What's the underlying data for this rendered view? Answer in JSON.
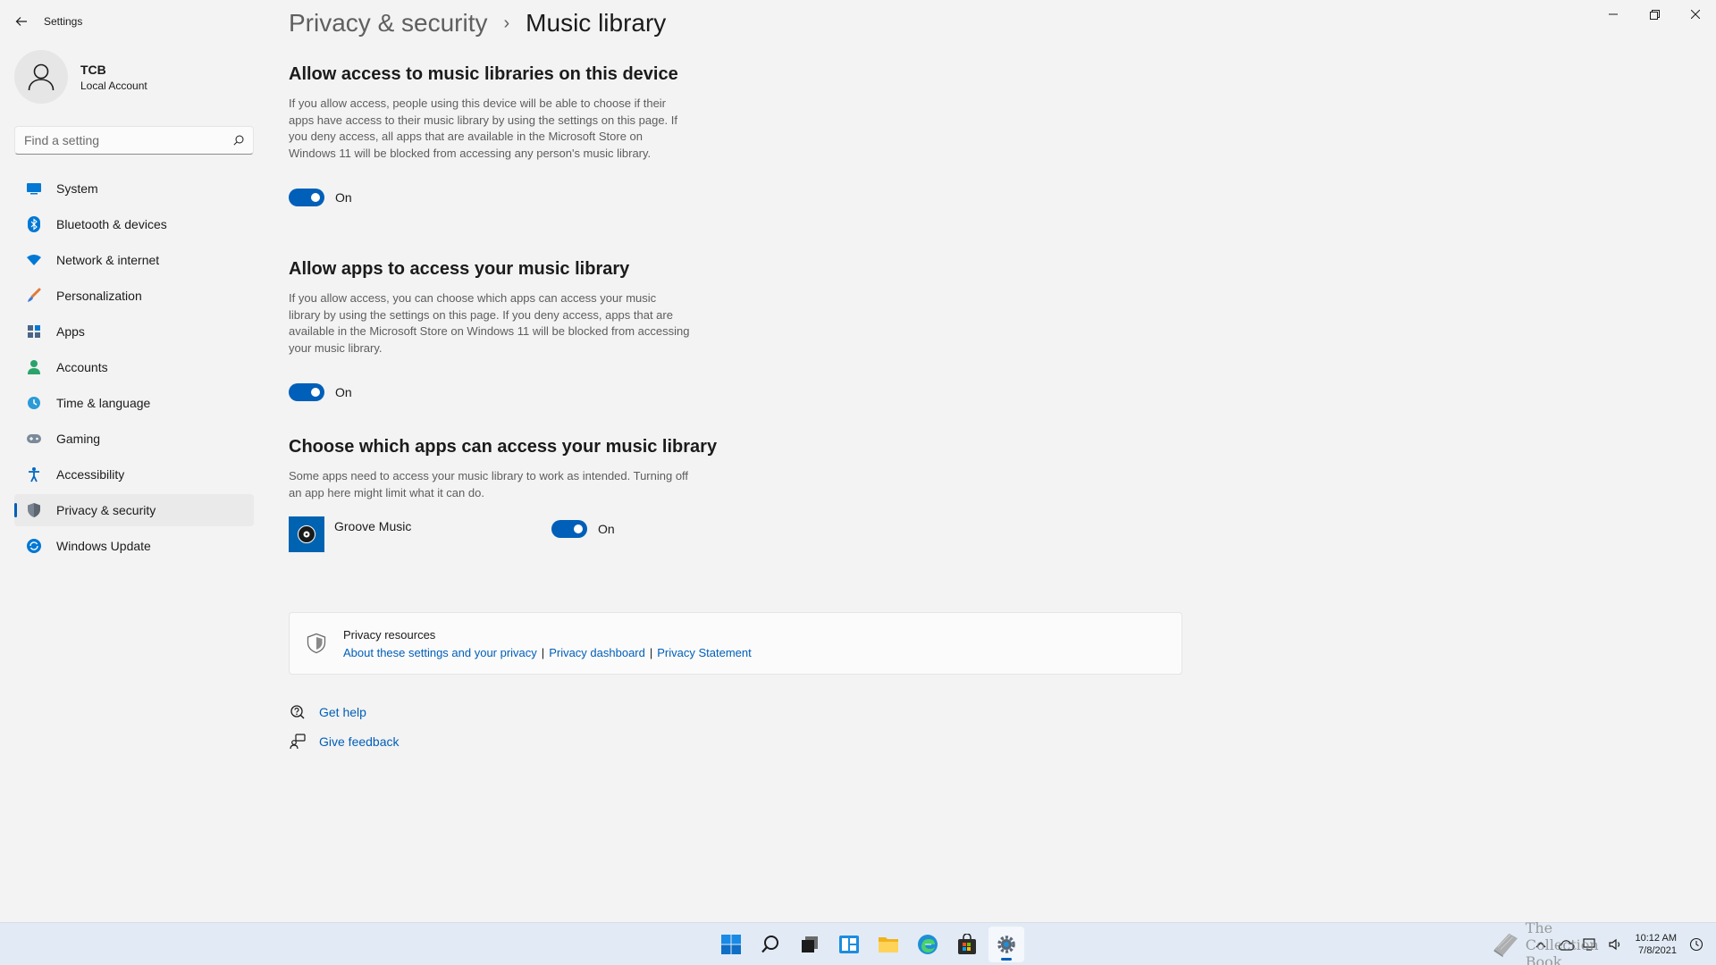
{
  "window": {
    "title": "Settings"
  },
  "profile": {
    "name": "TCB",
    "account_type": "Local Account"
  },
  "search": {
    "placeholder": "Find a setting"
  },
  "sidebar": {
    "items": [
      {
        "label": "System",
        "icon": "system-icon"
      },
      {
        "label": "Bluetooth & devices",
        "icon": "bluetooth-icon"
      },
      {
        "label": "Network & internet",
        "icon": "wifi-icon"
      },
      {
        "label": "Personalization",
        "icon": "brush-icon"
      },
      {
        "label": "Apps",
        "icon": "apps-icon"
      },
      {
        "label": "Accounts",
        "icon": "person-icon"
      },
      {
        "label": "Time & language",
        "icon": "globe-clock-icon"
      },
      {
        "label": "Gaming",
        "icon": "gamepad-icon"
      },
      {
        "label": "Accessibility",
        "icon": "accessibility-icon"
      },
      {
        "label": "Privacy & security",
        "icon": "shield-icon",
        "active": true
      },
      {
        "label": "Windows Update",
        "icon": "update-icon"
      }
    ]
  },
  "breadcrumb": {
    "parent": "Privacy & security",
    "separator": "›",
    "current": "Music library"
  },
  "sections": {
    "device_access": {
      "title": "Allow access to music libraries on this device",
      "description": "If you allow access, people using this device will be able to choose if their apps have access to their music library by using the settings on this page. If you deny access, all apps that are available in the Microsoft Store on Windows 11 will be blocked from accessing any person's music library.",
      "toggle_label": "On",
      "toggle_on": true
    },
    "app_access": {
      "title": "Allow apps to access your music library",
      "description": "If you allow access, you can choose which apps can access your music library by using the settings on this page. If you deny access, apps that are available in the Microsoft Store on Windows 11 will be blocked from accessing your music library.",
      "toggle_label": "On",
      "toggle_on": true
    },
    "choose_apps": {
      "title": "Choose which apps can access your music library",
      "description": "Some apps need to access your music library to work as intended. Turning off an app here might limit what it can do."
    }
  },
  "apps": [
    {
      "name": "Groove Music",
      "toggle_label": "On",
      "toggle_on": true
    }
  ],
  "privacy_resources": {
    "title": "Privacy resources",
    "links": [
      "About these settings and your privacy",
      "Privacy dashboard",
      "Privacy Statement"
    ],
    "separator": "|"
  },
  "help": {
    "get_help": "Get help",
    "give_feedback": "Give feedback"
  },
  "taskbar": {
    "apps": [
      "start-icon",
      "search-icon",
      "task-view-icon",
      "widgets-icon",
      "file-explorer-icon",
      "edge-icon",
      "store-icon",
      "settings-icon"
    ],
    "time": "10:12 AM",
    "date": "7/8/2021"
  },
  "watermark": {
    "text": "The Collection Book"
  },
  "colors": {
    "accent": "#005fb8",
    "background": "#f3f3f3"
  }
}
